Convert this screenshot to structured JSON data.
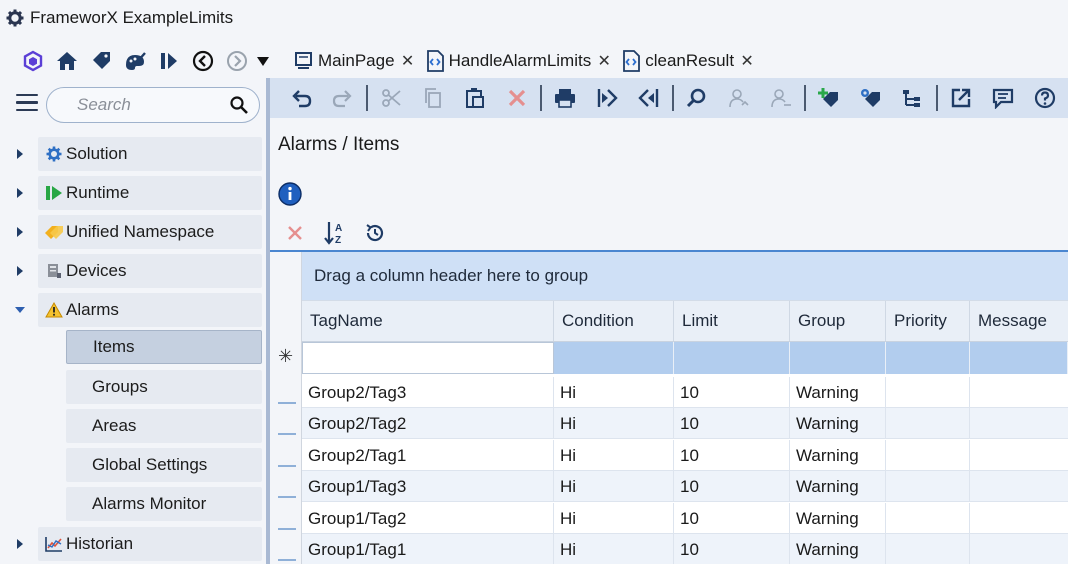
{
  "window": {
    "title": "FrameworX ExampleLimits"
  },
  "tabs": [
    {
      "label": "MainPage"
    },
    {
      "label": "HandleAlarmLimits"
    },
    {
      "label": "cleanResult"
    }
  ],
  "search": {
    "placeholder": "Search"
  },
  "tree": {
    "items": [
      {
        "label": "Solution"
      },
      {
        "label": "Runtime"
      },
      {
        "label": "Unified Namespace"
      },
      {
        "label": "Devices"
      },
      {
        "label": "Alarms"
      },
      {
        "label": "Historian"
      }
    ],
    "alarms_children": [
      {
        "label": "Items"
      },
      {
        "label": "Groups"
      },
      {
        "label": "Areas"
      },
      {
        "label": "Global Settings"
      },
      {
        "label": "Alarms Monitor"
      }
    ]
  },
  "main": {
    "breadcrumb": "Alarms / Items",
    "group_panel_text": "Drag a column header here to group",
    "columns": [
      "TagName",
      "Condition",
      "Limit",
      "Group",
      "Priority",
      "Message"
    ],
    "new_row_marker": "✳",
    "rows": [
      {
        "tagname": "Group2/Tag3",
        "condition": "Hi",
        "limit": "10",
        "group": "Warning",
        "priority": "",
        "message": ""
      },
      {
        "tagname": "Group2/Tag2",
        "condition": "Hi",
        "limit": "10",
        "group": "Warning",
        "priority": "",
        "message": ""
      },
      {
        "tagname": "Group2/Tag1",
        "condition": "Hi",
        "limit": "10",
        "group": "Warning",
        "priority": "",
        "message": ""
      },
      {
        "tagname": "Group1/Tag3",
        "condition": "Hi",
        "limit": "10",
        "group": "Warning",
        "priority": "",
        "message": ""
      },
      {
        "tagname": "Group1/Tag2",
        "condition": "Hi",
        "limit": "10",
        "group": "Warning",
        "priority": "",
        "message": ""
      },
      {
        "tagname": "Group1/Tag1",
        "condition": "Hi",
        "limit": "10",
        "group": "Warning",
        "priority": "",
        "message": ""
      }
    ]
  },
  "colors": {
    "accent": "#4a86d0",
    "toolbar_bg": "#d6e1f1",
    "icon_dark": "#1f3c66"
  }
}
